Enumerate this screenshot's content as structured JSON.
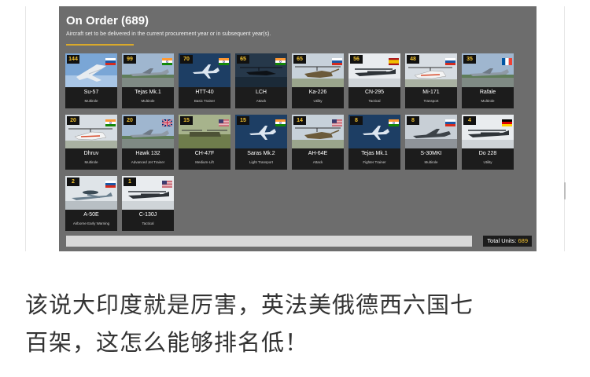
{
  "panel": {
    "title": "On Order (689)",
    "subtitle": "Aircraft set to be delivered in the current procurement year or in subsequent year(s).",
    "accent_color": "#d9a92b",
    "total_label": "Total Units:",
    "total_value": "689"
  },
  "aircraft": [
    {
      "count": "144",
      "name": "Su-57",
      "role": "Multirole",
      "flag": "russia",
      "scene": "sky"
    },
    {
      "count": "99",
      "name": "Tejas Mk.1",
      "role": "Multirole",
      "flag": "india",
      "scene": "runway"
    },
    {
      "count": "70",
      "name": "HTT-40",
      "role": "Basic Trainer",
      "flag": "india",
      "scene": "silhouette"
    },
    {
      "count": "65",
      "name": "LCH",
      "role": "Attack",
      "flag": "india",
      "scene": "heli-dark"
    },
    {
      "count": "65",
      "name": "Ka-226",
      "role": "Utility",
      "flag": "russia",
      "scene": "heli"
    },
    {
      "count": "56",
      "name": "CN-295",
      "role": "Tactical",
      "flag": "spain",
      "scene": "transport"
    },
    {
      "count": "48",
      "name": "Mi-171",
      "role": "Transport",
      "flag": "russia",
      "scene": "heli-white"
    },
    {
      "count": "35",
      "name": "Rafale",
      "role": "Multirole",
      "flag": "france",
      "scene": "runway"
    },
    {
      "count": "20",
      "name": "Dhruv",
      "role": "Multirole",
      "flag": "india",
      "scene": "heli-white"
    },
    {
      "count": "20",
      "name": "Hawk 132",
      "role": "Advanced Jet Trainer",
      "flag": "uk",
      "scene": "runway"
    },
    {
      "count": "15",
      "name": "CH-47F",
      "role": "Medium-Lift",
      "flag": "usa",
      "scene": "ground"
    },
    {
      "count": "15",
      "name": "Saras Mk.2",
      "role": "Light Transport",
      "flag": "india",
      "scene": "silhouette"
    },
    {
      "count": "14",
      "name": "AH-64E",
      "role": "Attack",
      "flag": "usa",
      "scene": "heli"
    },
    {
      "count": "8",
      "name": "Tejas Mk.1",
      "role": "Fighter Trainer",
      "flag": "india",
      "scene": "silhouette"
    },
    {
      "count": "8",
      "name": "S-30MKI",
      "role": "Multirole",
      "flag": "russia",
      "scene": "jet-grey"
    },
    {
      "count": "4",
      "name": "Do 228",
      "role": "Utility",
      "flag": "germany",
      "scene": "transport"
    },
    {
      "count": "2",
      "name": "A-50E",
      "role": "Airborne Early Warning",
      "flag": "russia",
      "scene": "awacs"
    },
    {
      "count": "1",
      "name": "C-130J",
      "role": "Tactical",
      "flag": "usa",
      "scene": "transport"
    }
  ],
  "caption": {
    "line1": "该说大印度就是厉害，英法美俄德西六国七",
    "line2": "百架，这怎么能够排名低！"
  },
  "colors": {
    "panel_bg": "#6d6d6d",
    "card_bg": "#1c1c1c",
    "count_text": "#f2c230"
  }
}
